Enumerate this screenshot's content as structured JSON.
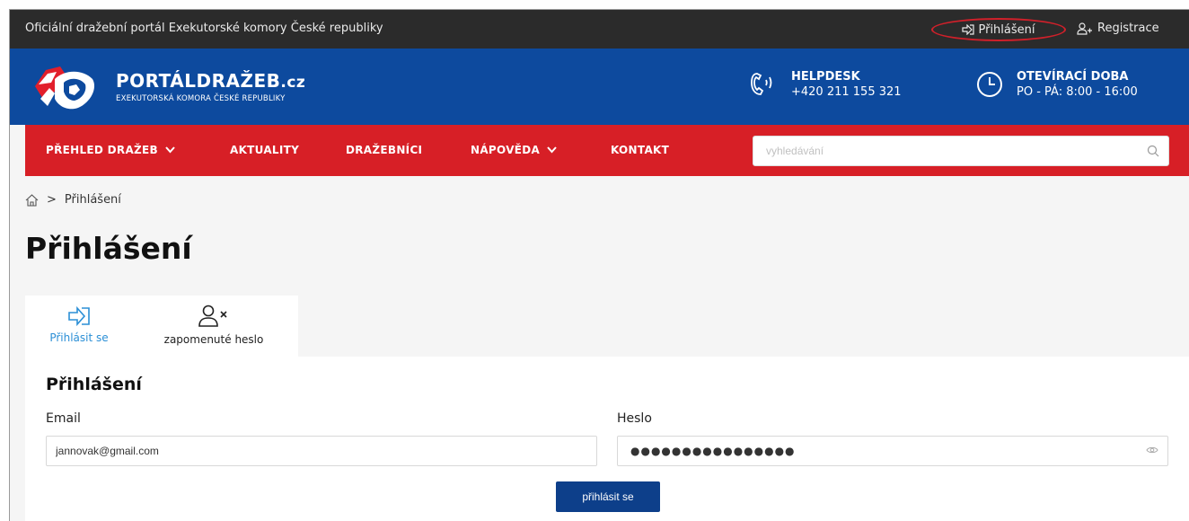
{
  "topbar": {
    "official_text": "Oficiální dražební portál Exekutorské komory České republiky",
    "login_label": "Přihlášení",
    "register_label": "Registrace"
  },
  "header": {
    "brand_name": "PORTÁLDRAŽEB",
    "brand_tld": ".cz",
    "brand_subtitle": "EXEKUTORSKÁ KOMORA ČESKÉ REPUBLIKY",
    "helpdesk_title": "HELPDESK",
    "helpdesk_phone": "+420 211 155 321",
    "hours_title": "OTEVÍRACÍ DOBA",
    "hours_text": "PO - PÁ: 8:00 - 16:00"
  },
  "nav": {
    "items": [
      {
        "label": "PŘEHLED DRAŽEB",
        "dropdown": true
      },
      {
        "label": "AKTUALITY",
        "dropdown": false
      },
      {
        "label": "DRAŽEBNÍCI",
        "dropdown": false
      },
      {
        "label": "NÁPOVĚDA",
        "dropdown": true
      },
      {
        "label": "KONTAKT",
        "dropdown": false
      }
    ],
    "search_placeholder": "vyhledávání"
  },
  "breadcrumb": {
    "separator": ">",
    "current": "Přihlášení"
  },
  "page_title": "Přihlášení",
  "tabs": [
    {
      "label": "Přihlásit se",
      "icon": "login-icon",
      "active": true
    },
    {
      "label": "zapomenuté heslo",
      "icon": "user-remove-icon",
      "active": false
    }
  ],
  "form": {
    "title": "Přihlášení",
    "email_label": "Email",
    "email_value": "jannovak@gmail.com",
    "password_label": "Heslo",
    "password_mask": "●●●●●●●●●●●●●●●●",
    "submit_label": "přihlásit se"
  },
  "colors": {
    "topbar": "#2b2b2b",
    "header_blue": "#0d4a9e",
    "nav_red": "#d71f26",
    "active_tab": "#2b8fd6",
    "submit": "#0d3f8a",
    "highlight_ring": "#d0202a"
  }
}
